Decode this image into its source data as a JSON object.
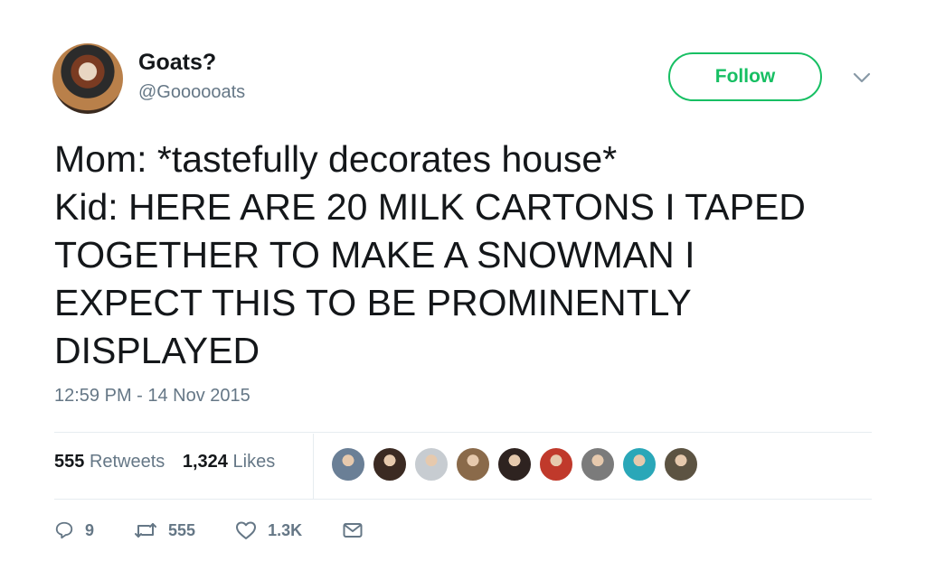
{
  "user": {
    "display_name": "Goats?",
    "handle": "@Goooooats",
    "follow_label": "Follow"
  },
  "tweet": {
    "lines": [
      "Mom: *tastefully decorates house*",
      "Kid: HERE ARE 20 MILK CARTONS I TAPED",
      "TOGETHER TO MAKE A SNOWMAN I",
      "EXPECT THIS TO BE PROMINENTLY",
      "DISPLAYED"
    ],
    "timestamp": "12:59 PM - 14 Nov 2015"
  },
  "stats": {
    "retweets_count": "555",
    "retweets_label": "Retweets",
    "likes_count": "1,324",
    "likes_label": "Likes"
  },
  "likers": [
    "#6a7f96",
    "#3b2a22",
    "#c7ccd1",
    "#8a6a4a",
    "#2e2320",
    "#c0392b",
    "#7b7b7b",
    "#2aa7b8",
    "#5c5342"
  ],
  "actions": {
    "replies": "9",
    "retweets": "555",
    "likes": "1.3K"
  },
  "icons": {
    "reply": "reply-icon",
    "retweet": "retweet-icon",
    "like": "heart-icon",
    "message": "envelope-icon",
    "menu": "chevron-down-icon"
  }
}
